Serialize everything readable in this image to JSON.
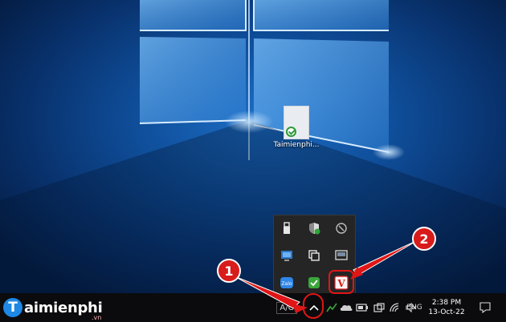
{
  "desktop": {
    "icon_label": "Taimienphi..."
  },
  "tray_flyout": {
    "icons": [
      {
        "name": "usb-eject-icon"
      },
      {
        "name": "windows-security-icon"
      },
      {
        "name": "network-globe-icon"
      },
      {
        "name": "monitor-app-icon"
      },
      {
        "name": "copy-windows-icon"
      },
      {
        "name": "display-panel-icon"
      },
      {
        "name": "zalo-icon",
        "text": "Zalo"
      },
      {
        "name": "green-shield-icon"
      },
      {
        "name": "v-app-icon",
        "text": "V"
      }
    ]
  },
  "taskbar": {
    "pinned_text": "A/C",
    "language": "ENG",
    "time": "2:38 PM",
    "date": "13-Oct-22"
  },
  "watermark": {
    "name": "aimienphi",
    "letter": "T",
    "suffix": ".vn"
  },
  "annotations": {
    "badge_1": "1",
    "badge_2": "2"
  },
  "colors": {
    "accent_red": "#e01616",
    "taskbar_bg": "#0b0b0d",
    "flyout_bg": "#252525",
    "desktop_blue": "#0f4e9a"
  }
}
